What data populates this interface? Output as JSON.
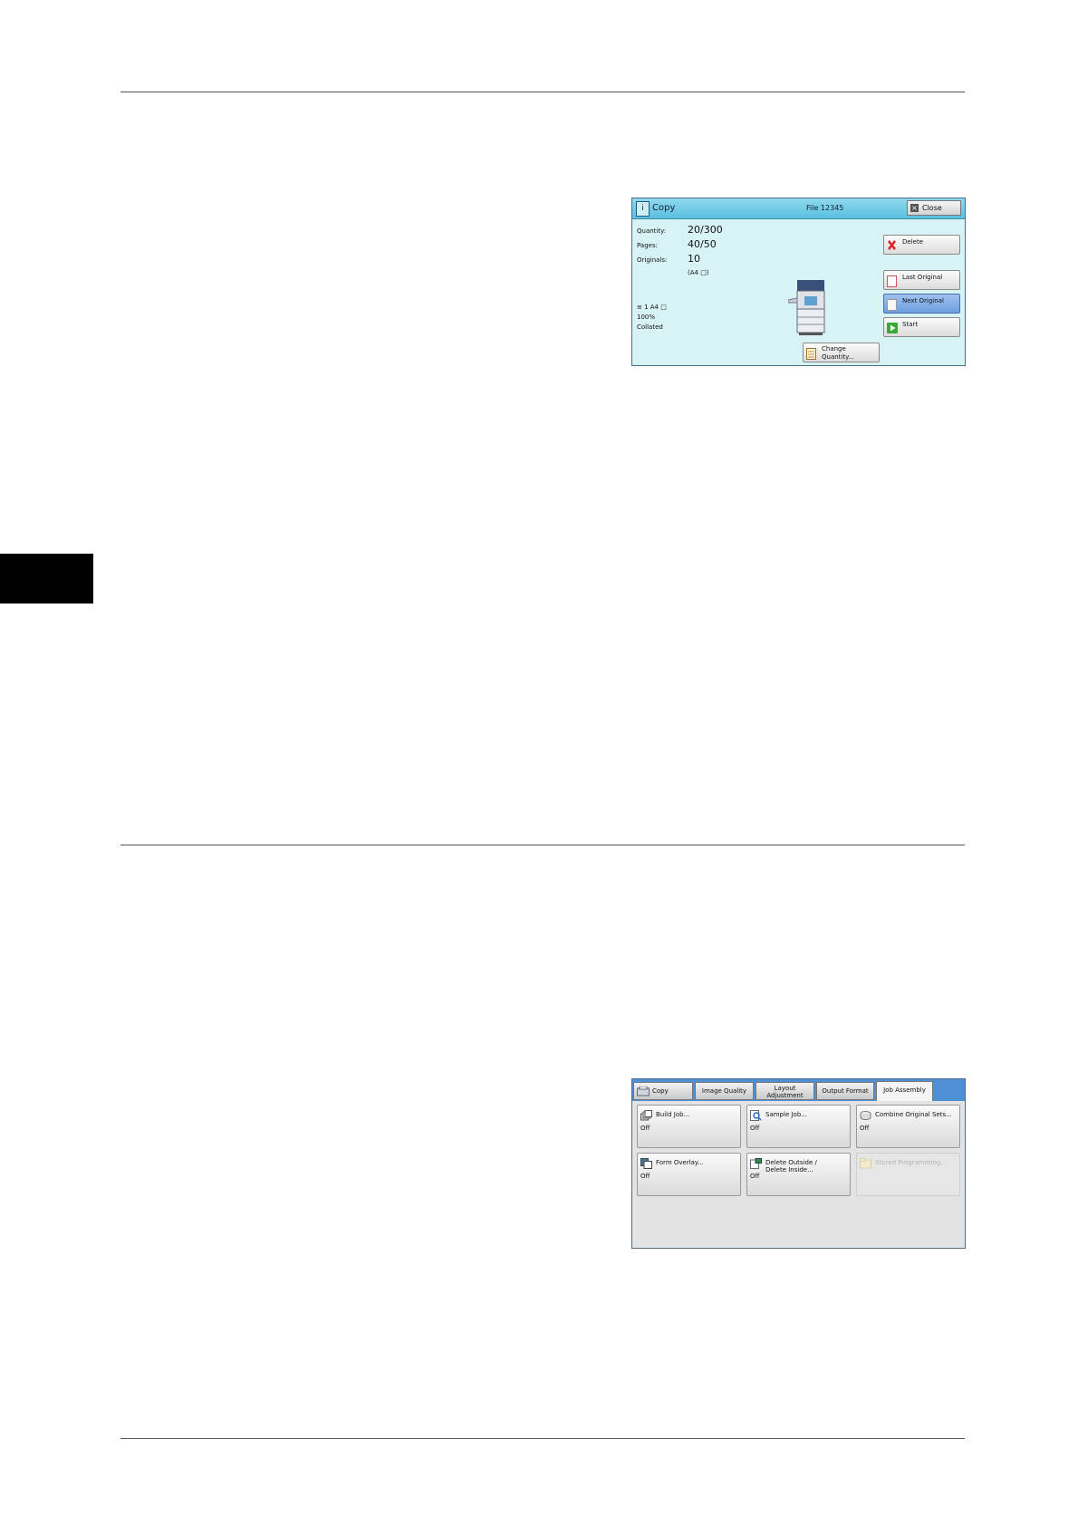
{
  "panel1": {
    "title": "Copy",
    "file": "File 12345",
    "close_label": "Close",
    "quantity_label": "Quantity:",
    "quantity_value": "20/300",
    "pages_label": "Pages:",
    "pages_value": "40/50",
    "originals_label": "Originals:",
    "originals_value": "10",
    "originals_size": "(A4 □)",
    "tray_line": "≡ 1    A4 □",
    "ratio": "100%",
    "finishing": "Collated",
    "buttons": {
      "delete": "Delete",
      "last_original": "Last Original",
      "next_original": "Next Original",
      "start": "Start",
      "change_quantity_1": "Change",
      "change_quantity_2": "Quantity..."
    }
  },
  "panel2": {
    "tabs": [
      "Copy",
      "Image Quality",
      "Layout",
      "Adjustment",
      "Output Format",
      "Job Assembly"
    ],
    "features": [
      {
        "label": "Build Job...",
        "status": "Off"
      },
      {
        "label": "Sample Job...",
        "status": "Off"
      },
      {
        "label": "Combine Original Sets...",
        "status": "Off"
      },
      {
        "label": "Form Overlay...",
        "status": "Off"
      },
      {
        "label": "Delete Outside /",
        "label2": "Delete Inside...",
        "status": "Off"
      },
      {
        "label": "Stored Programming...",
        "status": ""
      }
    ]
  }
}
